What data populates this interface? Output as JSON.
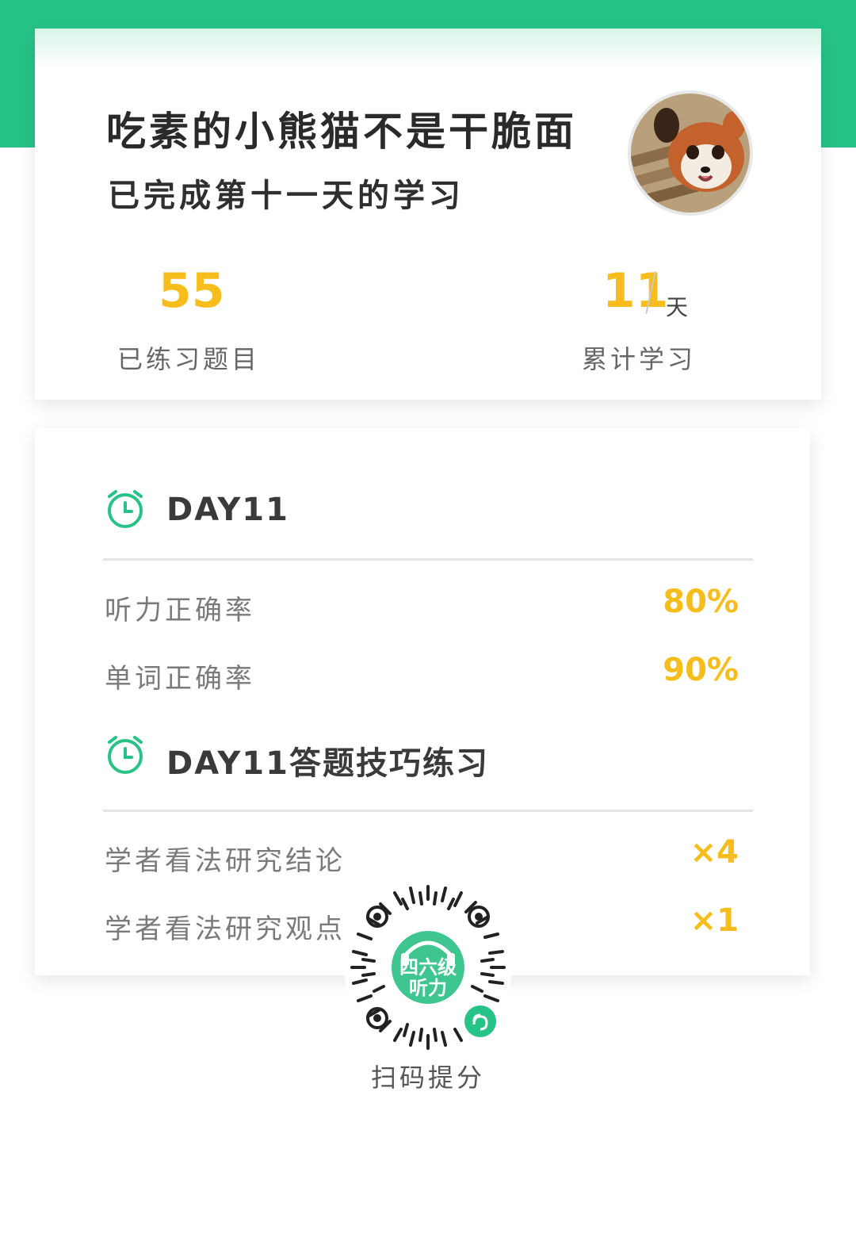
{
  "header": {
    "username": "吃素的小熊猫不是干脆面",
    "subtitle": "已完成第十一天的学习",
    "avatar_icon": "red-panda-avatar"
  },
  "stats": {
    "practiced": {
      "value": "55",
      "label": "已练习题目"
    },
    "days": {
      "value": "11",
      "unit": "天",
      "label": "累计学习"
    }
  },
  "day_section": {
    "title": "DAY11",
    "icon": "alarm-clock-icon",
    "rows": [
      {
        "label": "听力正确率",
        "value": "80%"
      },
      {
        "label": "单词正确率",
        "value": "90%"
      }
    ]
  },
  "skills_section": {
    "title": "DAY11答题技巧练习",
    "icon": "alarm-clock-icon",
    "rows": [
      {
        "label": "学者看法研究结论",
        "value": "×4"
      },
      {
        "label": "学者看法研究观点",
        "value": "×1"
      }
    ]
  },
  "qr": {
    "badge_line1": "四六级",
    "badge_line2": "听力",
    "caption": "扫码提分",
    "icon": "mini-program-qr-code"
  },
  "colors": {
    "brand_green": "#27c386",
    "accent_yellow": "#f7bd1c"
  }
}
